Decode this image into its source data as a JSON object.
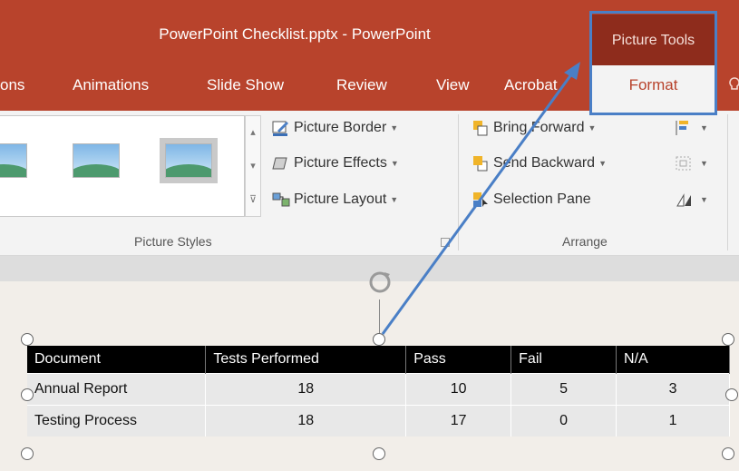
{
  "window": {
    "title": "PowerPoint Checklist.pptx - PowerPoint",
    "context_tab_group": "Picture Tools"
  },
  "tabs": {
    "items": [
      "ons",
      "Animations",
      "Slide Show",
      "Review",
      "View",
      "Acrobat"
    ],
    "active": "Format"
  },
  "ribbon": {
    "picture_styles": {
      "buttons": [
        "Picture Border",
        "Picture Effects",
        "Picture Layout"
      ],
      "label": "Picture Styles"
    },
    "arrange": {
      "buttons": [
        "Bring Forward",
        "Send Backward",
        "Selection Pane"
      ],
      "label": "Arrange"
    }
  },
  "table": {
    "headers": [
      "Document",
      "Tests Performed",
      "Pass",
      "Fail",
      "N/A"
    ],
    "rows": [
      [
        "Annual Report",
        "18",
        "10",
        "5",
        "3"
      ],
      [
        "Testing Process",
        "18",
        "17",
        "0",
        "1"
      ]
    ]
  },
  "colors": {
    "title_bar": "#b8432c",
    "context_group": "#8e2c1c",
    "highlight": "#4a7fc6",
    "arrow": "#4a7fc6"
  },
  "icons": [
    "rotate-handle-icon",
    "picture-border-icon",
    "picture-effects-icon",
    "picture-layout-icon",
    "bring-forward-icon",
    "send-backward-icon",
    "selection-pane-icon",
    "align-icon",
    "group-icon",
    "rotate-icon",
    "tell-me-icon"
  ]
}
